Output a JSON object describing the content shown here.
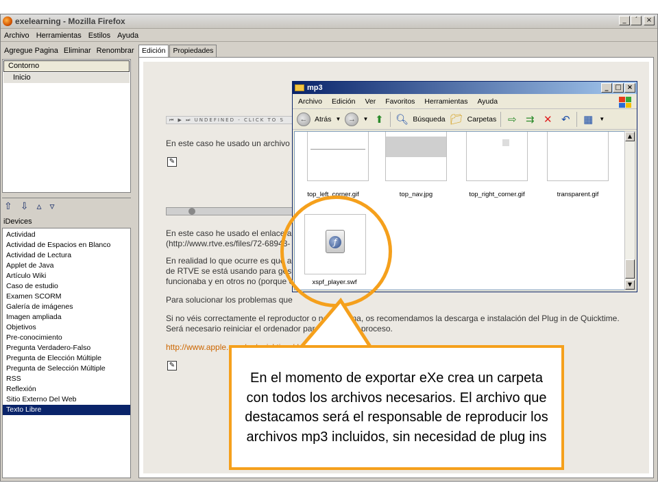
{
  "window": {
    "title": "exelearning - Mozilla Firefox",
    "buttons": [
      "_",
      "´",
      "×"
    ]
  },
  "menubar": [
    "Archivo",
    "Herramientas",
    "Estilos",
    "Ayuda"
  ],
  "left": {
    "nav_buttons": [
      "Agregue Pagina",
      "Eliminar",
      "Renombrar"
    ],
    "outline_header": "Contorno",
    "outline_item": "Inicio",
    "idevices_label": "iDevices",
    "idevices": [
      "Actividad",
      "Actividad de Espacios en Blanco",
      "Actividad de Lectura",
      "Applet de Java",
      "Artículo Wiki",
      "Caso de estudio",
      "Examen SCORM",
      "Galería de imágenes",
      "Imagen ampliada",
      "Objetivos",
      "Pre-conocimiento",
      "Pregunta Verdadero-Falso",
      "Pregunta de Elección Múltiple",
      "Pregunta de Selección Múltiple",
      "RSS",
      "Reflexión",
      "Sitio Externo Del Web",
      "Texto Libre"
    ],
    "selected_idevice": "Texto Libre"
  },
  "tabs": [
    "Edición",
    "Propiedades"
  ],
  "content": {
    "player1_text": "UNDEFINED - CLICK TO S",
    "p1": "En este caso he usado un archivo",
    "p2_line1": "En este caso he usado el enlace a",
    "p2_line2": "(http://www.rtve.es/files/72-68943-",
    "p3_line1": "En realidad lo que ocurre es que a",
    "p3_line2": "de RTVE se está usando para ges",
    "p3_line3": "funcionaba y en otros no (porque e",
    "p4": "Para solucionar los problemas que",
    "p5_line1": "Si no véis correctamente el reproductor o no funciona, os recomendamos la descarga e instalación del Plug in de Quicktime.",
    "p5_line2": "Será necesario reiniciar el ordenador para finalizar el proceso.",
    "link": "http://www.apple.com/es/quicktime/do"
  },
  "explorer": {
    "title": "mp3",
    "menu": [
      "Archivo",
      "Edición",
      "Ver",
      "Favoritos",
      "Herramientas",
      "Ayuda"
    ],
    "back_label": "Atrás",
    "search_label": "Búsqueda",
    "folders_label": "Carpetas",
    "files": [
      "top_left_corner.gif",
      "top_nav.jpg",
      "top_right_corner.gif",
      "transparent.gif",
      "xspf_player.swf"
    ]
  },
  "callout": {
    "text": "En el momento de exportar eXe crea un carpeta con todos los archivos necesarios. El archivo que destacamos será el responsable de reproducir los archivos mp3 incluidos, sin necesidad de plug ins"
  },
  "colors": {
    "highlight": "#f5a01c",
    "selection": "#0a246a",
    "link": "#cc6600"
  }
}
